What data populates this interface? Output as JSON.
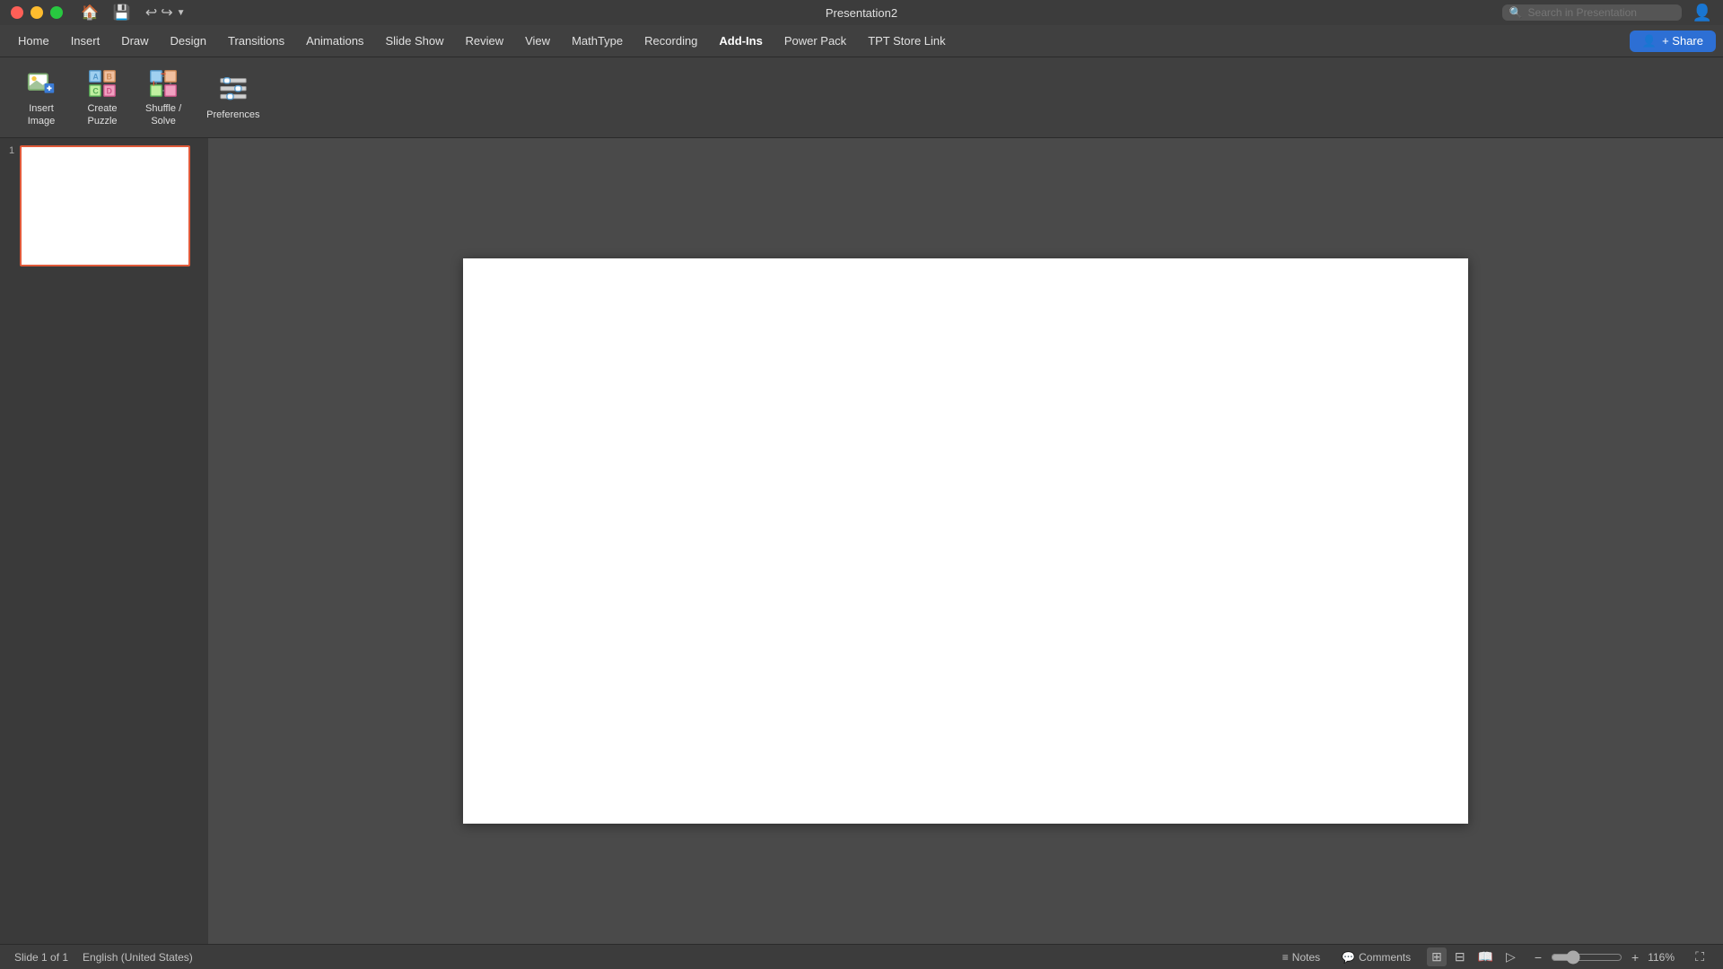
{
  "titlebar": {
    "title": "Presentation2",
    "search_placeholder": "Search in Presentation"
  },
  "menu": {
    "items": [
      {
        "label": "Home",
        "id": "home"
      },
      {
        "label": "Insert",
        "id": "insert"
      },
      {
        "label": "Draw",
        "id": "draw"
      },
      {
        "label": "Design",
        "id": "design"
      },
      {
        "label": "Transitions",
        "id": "transitions"
      },
      {
        "label": "Animations",
        "id": "animations"
      },
      {
        "label": "Slide Show",
        "id": "slideshow"
      },
      {
        "label": "Review",
        "id": "review"
      },
      {
        "label": "View",
        "id": "view"
      },
      {
        "label": "MathType",
        "id": "mathtype"
      },
      {
        "label": "Recording",
        "id": "recording"
      },
      {
        "label": "Add-Ins",
        "id": "addins"
      },
      {
        "label": "Power Pack",
        "id": "powerpack"
      },
      {
        "label": "TPT Store Link",
        "id": "tptstorelink"
      }
    ],
    "share_label": "+ Share"
  },
  "ribbon": {
    "items": [
      {
        "id": "insert-image",
        "label": "Insert\nImage",
        "icon": "insert-image"
      },
      {
        "id": "create-puzzle",
        "label": "Create\nPuzzle",
        "icon": "create-puzzle"
      },
      {
        "id": "shuffle-solve",
        "label": "Shuffle /\nSolve",
        "icon": "shuffle-solve"
      },
      {
        "id": "preferences",
        "label": "Preferences",
        "icon": "preferences"
      }
    ]
  },
  "slides": [
    {
      "number": 1,
      "id": "slide-1"
    }
  ],
  "statusbar": {
    "slide_info": "Slide 1 of 1",
    "language": "English (United States)",
    "notes_label": "Notes",
    "comments_label": "Comments",
    "zoom_level": "116%"
  }
}
